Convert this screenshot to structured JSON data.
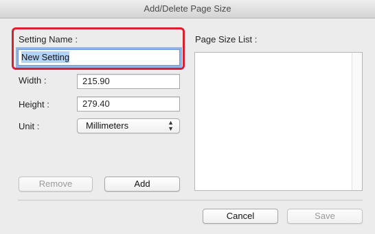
{
  "window": {
    "title": "Add/Delete Page Size"
  },
  "setting_name": {
    "label": "Setting Name :",
    "value": "New Setting"
  },
  "width": {
    "label": "Width :",
    "value": "215.90"
  },
  "height": {
    "label": "Height :",
    "value": "279.40"
  },
  "unit": {
    "label": "Unit :",
    "value": "Millimeters"
  },
  "page_size_list": {
    "label": "Page Size List :",
    "items": []
  },
  "buttons": {
    "remove": "Remove",
    "add": "Add",
    "cancel": "Cancel",
    "save": "Save"
  },
  "colors": {
    "highlight": "#d9202c",
    "focus_ring": "#8fb4e8",
    "selection": "#b4d2f5"
  }
}
